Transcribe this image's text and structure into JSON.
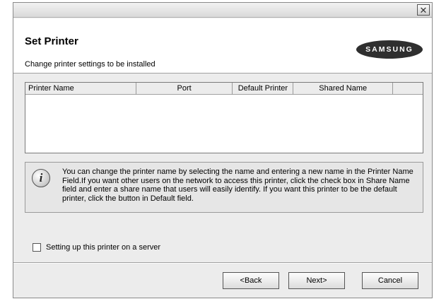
{
  "window": {
    "close_glyph": "✕"
  },
  "header": {
    "title": "Set Printer",
    "subtitle": "Change printer settings to be installed",
    "logo_text": "SAMSUNG"
  },
  "table": {
    "columns": [
      "Printer Name",
      "Port",
      "Default Printer",
      "Shared Name",
      ""
    ],
    "rows": []
  },
  "info": {
    "icon": "info-icon",
    "text": "You can change the printer name by selecting the name and entering a new name in the Printer Name Field.If you want other users on the network to access this printer, click the check box in Share Name field and enter a share name that users will easily identify. If you want this printer to be the default printer, click the button in Default field."
  },
  "server_option": {
    "label": "Setting up this printer on a server",
    "checked": false
  },
  "buttons": {
    "back": "<Back",
    "next": "Next>",
    "cancel": "Cancel"
  }
}
